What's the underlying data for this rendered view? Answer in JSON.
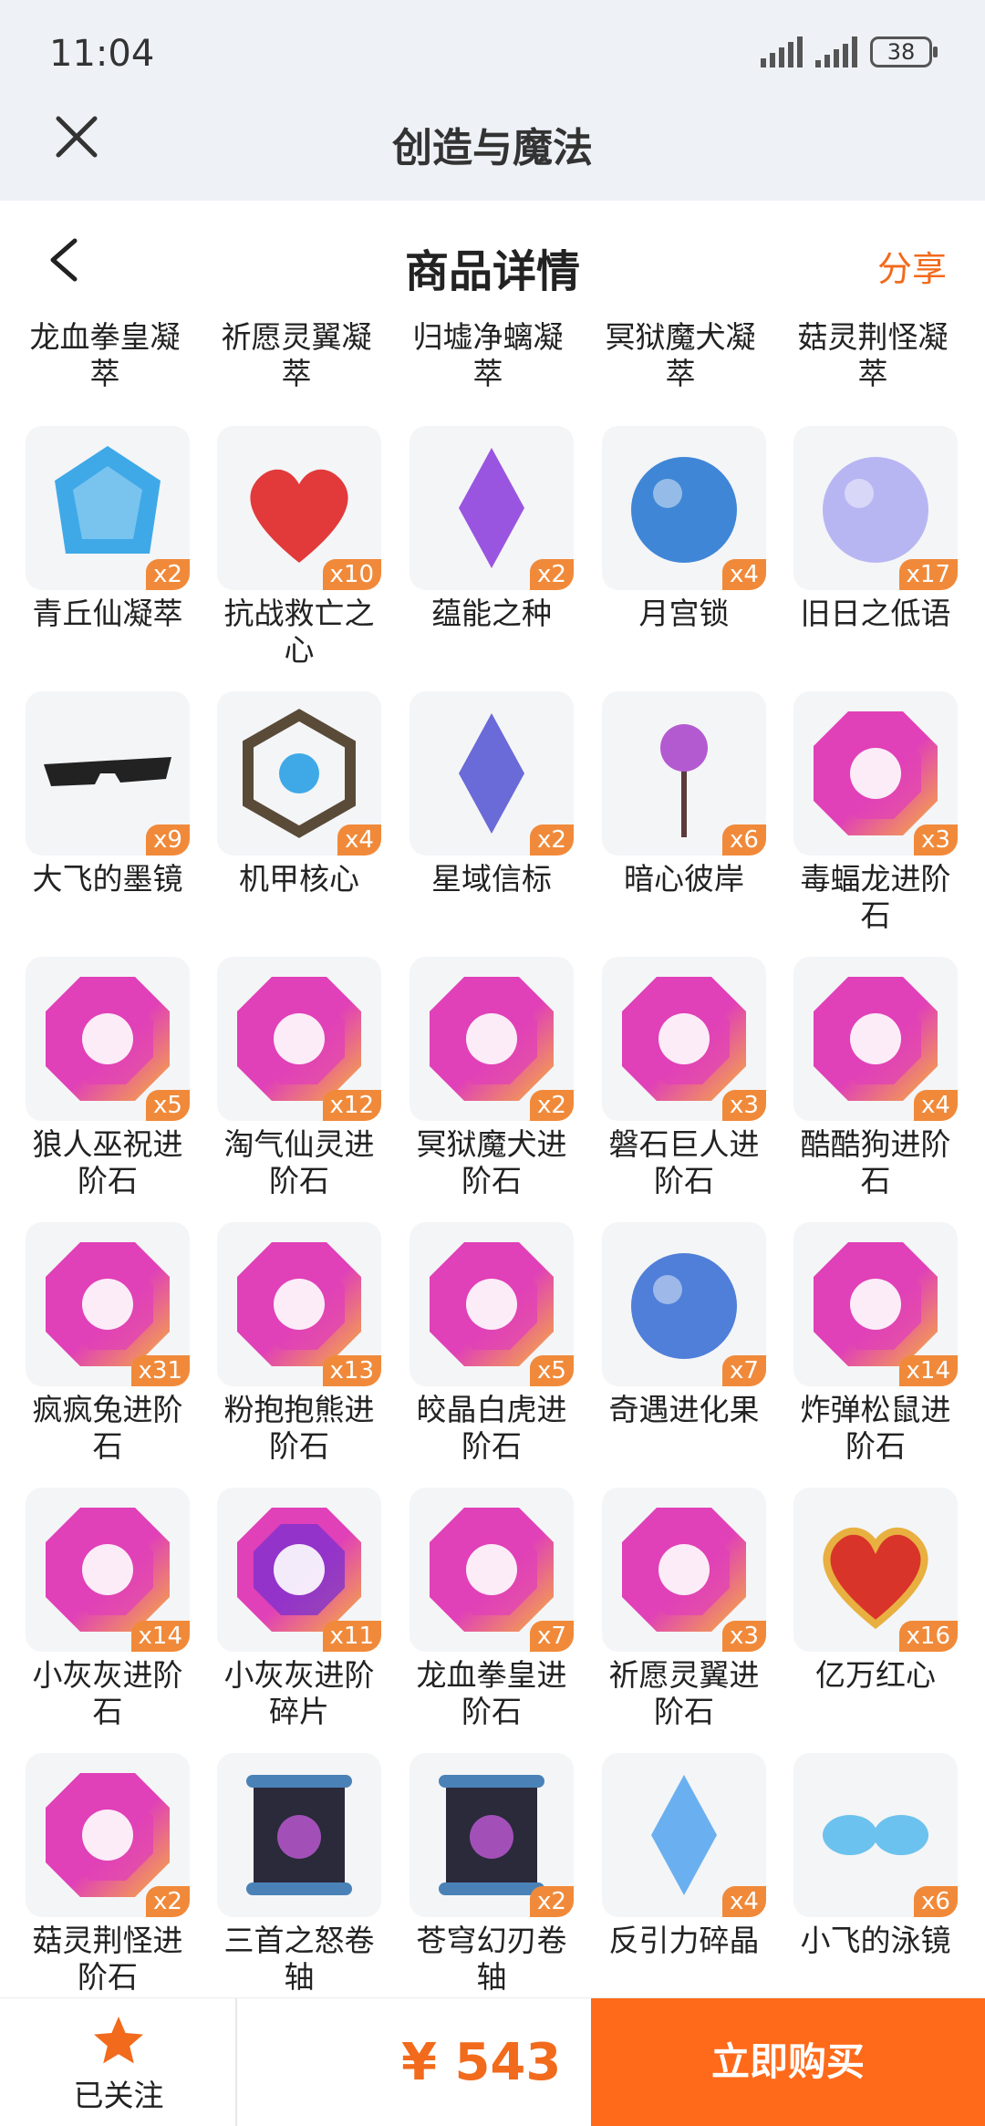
{
  "status_bar": {
    "time": "11:04",
    "battery": "38"
  },
  "app_header": {
    "title": "创造与魔法"
  },
  "page_header": {
    "title": "商品详情",
    "share_label": "分享"
  },
  "top_row_labels": [
    "龙血拳皇凝萃",
    "祈愿灵翼凝萃",
    "归墟净螭凝萃",
    "冥狱魔犬凝萃",
    "菇灵荆怪凝萃"
  ],
  "items": [
    {
      "label": "青丘仙凝萃",
      "count": "x2",
      "icon": "blue-crystal-dragon-icon",
      "color": "#3fa9e8"
    },
    {
      "label": "抗战救亡之心",
      "count": "x10",
      "icon": "red-heart-gem-icon",
      "color": "#e23a3a"
    },
    {
      "label": "蕴能之种",
      "count": "x2",
      "icon": "purple-crystal-seed-icon",
      "color": "#9a55e0"
    },
    {
      "label": "月宫锁",
      "count": "x4",
      "icon": "blue-moon-lock-icon",
      "color": "#3f86d6"
    },
    {
      "label": "旧日之低语",
      "count": "x17",
      "icon": "purple-orb-icon",
      "color": "#b8b6f2"
    },
    {
      "label": "大飞的墨镜",
      "count": "x9",
      "icon": "sunglasses-icon",
      "color": "#222"
    },
    {
      "label": "机甲核心",
      "count": "x4",
      "icon": "mech-core-icon",
      "color": "#5a4a38"
    },
    {
      "label": "星域信标",
      "count": "x2",
      "icon": "star-beacon-icon",
      "color": "#6a6ad8"
    },
    {
      "label": "暗心彼岸",
      "count": "x6",
      "icon": "spider-lily-icon",
      "color": "#b45ad0"
    },
    {
      "label": "毒蝠龙进阶石",
      "count": "x3",
      "icon": "advance-stone-bat-icon",
      "color": "#d63fc0"
    },
    {
      "label": "狼人巫祝进阶石",
      "count": "x5",
      "icon": "advance-stone-wolf-icon",
      "color": "#d63fc0"
    },
    {
      "label": "淘气仙灵进阶石",
      "count": "x12",
      "icon": "advance-stone-fairy-icon",
      "color": "#d63fc0"
    },
    {
      "label": "冥狱魔犬进阶石",
      "count": "x2",
      "icon": "advance-stone-hound-icon",
      "color": "#d63fc0"
    },
    {
      "label": "磐石巨人进阶石",
      "count": "x3",
      "icon": "advance-stone-giant-icon",
      "color": "#d63fc0"
    },
    {
      "label": "酷酷狗进阶石",
      "count": "x4",
      "icon": "advance-stone-dog-icon",
      "color": "#d63fc0"
    },
    {
      "label": "疯疯兔进阶石",
      "count": "x31",
      "icon": "advance-stone-rabbit-icon",
      "color": "#d63fc0"
    },
    {
      "label": "粉抱抱熊进阶石",
      "count": "x13",
      "icon": "advance-stone-bear-icon",
      "color": "#d63fc0"
    },
    {
      "label": "皎晶白虎进阶石",
      "count": "x5",
      "icon": "advance-stone-tiger-icon",
      "color": "#d63fc0"
    },
    {
      "label": "奇遇进化果",
      "count": "x7",
      "icon": "blue-berry-fruit-icon",
      "color": "#4f7fd8"
    },
    {
      "label": "炸弹松鼠进阶石",
      "count": "x14",
      "icon": "advance-stone-squirrel-icon",
      "color": "#d63fc0"
    },
    {
      "label": "小灰灰进阶石",
      "count": "x14",
      "icon": "advance-stone-lollipop-icon",
      "color": "#d63fc0"
    },
    {
      "label": "小灰灰进阶碎片",
      "count": "x11",
      "icon": "advance-fragment-lollipop-icon",
      "color": "#8a3fd6"
    },
    {
      "label": "龙血拳皇进阶石",
      "count": "x7",
      "icon": "advance-stone-dragon-icon",
      "color": "#d63fc0"
    },
    {
      "label": "祈愿灵翼进阶石",
      "count": "x3",
      "icon": "advance-stone-wing-icon",
      "color": "#d63fc0"
    },
    {
      "label": "亿万红心",
      "count": "x16",
      "icon": "golden-heart-icon",
      "color": "#d9342a"
    },
    {
      "label": "菇灵荆怪进阶石",
      "count": "x2",
      "icon": "advance-stone-mushroom-icon",
      "color": "#d63fc0"
    },
    {
      "label": "三首之怒卷轴",
      "count": "",
      "icon": "scroll-three-heads-icon",
      "color": "#2a2a3a"
    },
    {
      "label": "苍穹幻刃卷轴",
      "count": "x2",
      "icon": "scroll-blade-icon",
      "color": "#2a2a3a"
    },
    {
      "label": "反引力碎晶",
      "count": "x4",
      "icon": "anti-gravity-shard-icon",
      "color": "#6ab0f0"
    },
    {
      "label": "小飞的泳镜",
      "count": "x6",
      "icon": "swim-goggles-icon",
      "color": "#6cc2ee"
    }
  ],
  "bottom_bar": {
    "follow_label": "已关注",
    "price": "¥ 543",
    "buy_label": "立即购买"
  }
}
